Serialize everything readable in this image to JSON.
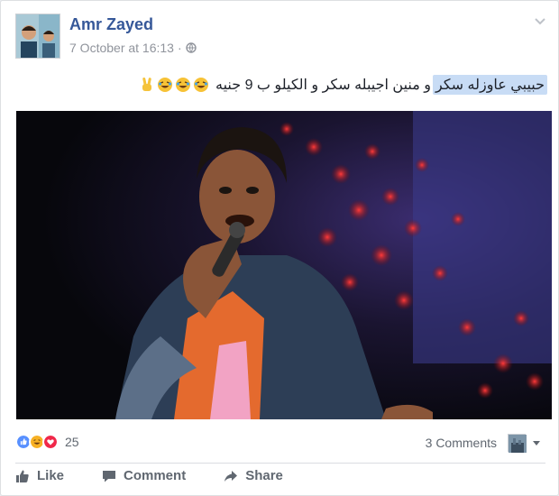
{
  "post": {
    "author": "Amr Zayed",
    "timestamp": "7 October at 16:13",
    "separator": "·",
    "privacy_icon": "globe-icon",
    "text_highlighted": "حبيبي عاوزله سكر",
    "text_rest": " و منين اجيبله سكر و الكيلو ب 9 جنيه",
    "emojis": [
      "laughing-emoji",
      "laughing-emoji",
      "laughing-emoji",
      "victory-hand-emoji"
    ]
  },
  "footer": {
    "reaction_icons": [
      "like",
      "haha",
      "love"
    ],
    "reaction_count": "25",
    "comments_label": "3 Comments",
    "actions": {
      "like": "Like",
      "comment": "Comment",
      "share": "Share"
    }
  },
  "colors": {
    "name_blue": "#365899",
    "highlight": "#c8dcf5",
    "like_blue": "#5890ff",
    "love_red": "#f0284a",
    "haha_yellow": "#f7b125"
  }
}
